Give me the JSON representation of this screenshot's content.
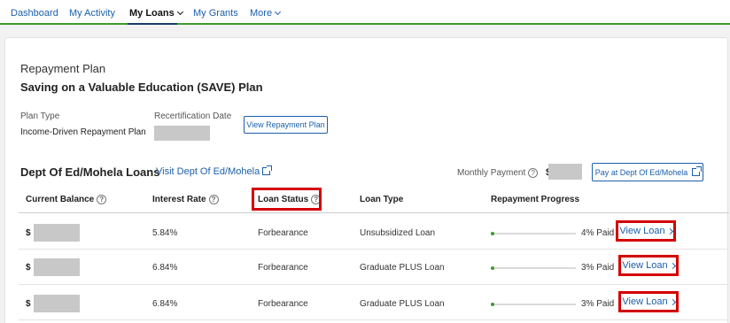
{
  "nav": {
    "items": [
      {
        "label": "Dashboard",
        "active": false
      },
      {
        "label": "My Activity",
        "active": false
      },
      {
        "label": "My Loans",
        "active": true,
        "dropdown": true
      },
      {
        "label": "My Grants",
        "active": false
      },
      {
        "label": "More",
        "active": false,
        "dropdown": true
      }
    ]
  },
  "repayment": {
    "section_label": "Repayment Plan",
    "plan_name": "Saving on a Valuable Education (SAVE) Plan",
    "plan_type_label": "Plan Type",
    "plan_type_value": "Income-Driven Repayment Plan",
    "recert_label": "Recertification Date",
    "view_plan_button": "View Repayment Plan"
  },
  "servicer": {
    "name": "Dept Of Ed/Mohela Loans",
    "visit_link": "Visit Dept Of Ed/Mohela",
    "monthly_label": "Monthly Payment",
    "currency": "$",
    "pay_button": "Pay at Dept Of Ed/Mohela"
  },
  "table": {
    "headers": {
      "balance": "Current Balance",
      "rate": "Interest Rate",
      "status": "Loan Status",
      "type": "Loan Type",
      "progress": "Repayment Progress"
    },
    "rows": [
      {
        "currency": "$",
        "rate": "5.84%",
        "status": "Forbearance",
        "type": "Unsubsidized Loan",
        "progress": 0.04,
        "paid": "4% Paid",
        "action": "View Loan"
      },
      {
        "currency": "$",
        "rate": "6.84%",
        "status": "Forbearance",
        "type": "Graduate PLUS Loan",
        "progress": 0.03,
        "paid": "3% Paid",
        "action": "View Loan"
      },
      {
        "currency": "$",
        "rate": "6.84%",
        "status": "Forbearance",
        "type": "Graduate PLUS Loan",
        "progress": 0.03,
        "paid": "3% Paid",
        "action": "View Loan"
      }
    ]
  },
  "colors": {
    "link": "#1b5faa",
    "accent_green": "#3f9a2e",
    "highlight_red": "#d40000",
    "redaction_gray": "#c8c8c8"
  }
}
